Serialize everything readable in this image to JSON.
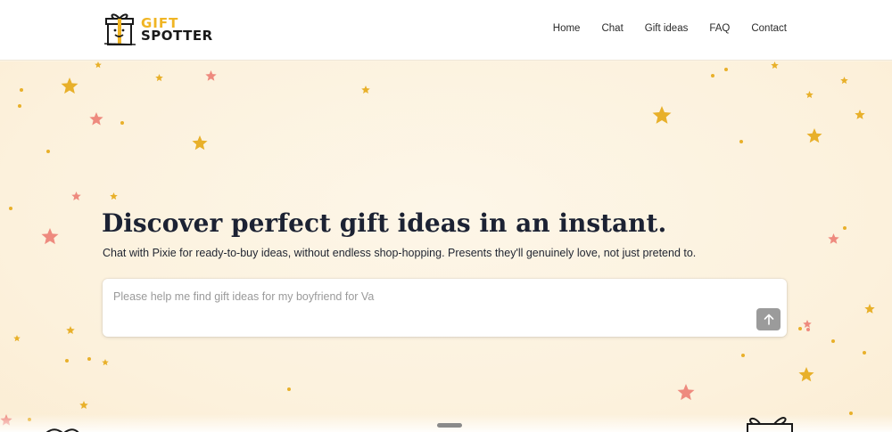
{
  "brand": {
    "top": "GIFT",
    "bottom": "SPOTTER",
    "accent": "#f0b524"
  },
  "nav": {
    "items": [
      {
        "label": "Home"
      },
      {
        "label": "Chat"
      },
      {
        "label": "Gift ideas"
      },
      {
        "label": "FAQ"
      },
      {
        "label": "Contact"
      }
    ]
  },
  "hero": {
    "headline": "Discover perfect gift ideas in an instant.",
    "subline": "Chat with Pixie for ready-to-buy ideas, without endless shop-hopping. Presents they'll genuinely love, not just pretend to."
  },
  "chat_input": {
    "placeholder": "Please help me find gift ideas for my boyfriend for Va",
    "send_icon": "arrow-up-icon"
  },
  "colors": {
    "star_gold": "#e8b02a",
    "star_pink": "#ee8a7e",
    "background": "#fdf4e3"
  }
}
